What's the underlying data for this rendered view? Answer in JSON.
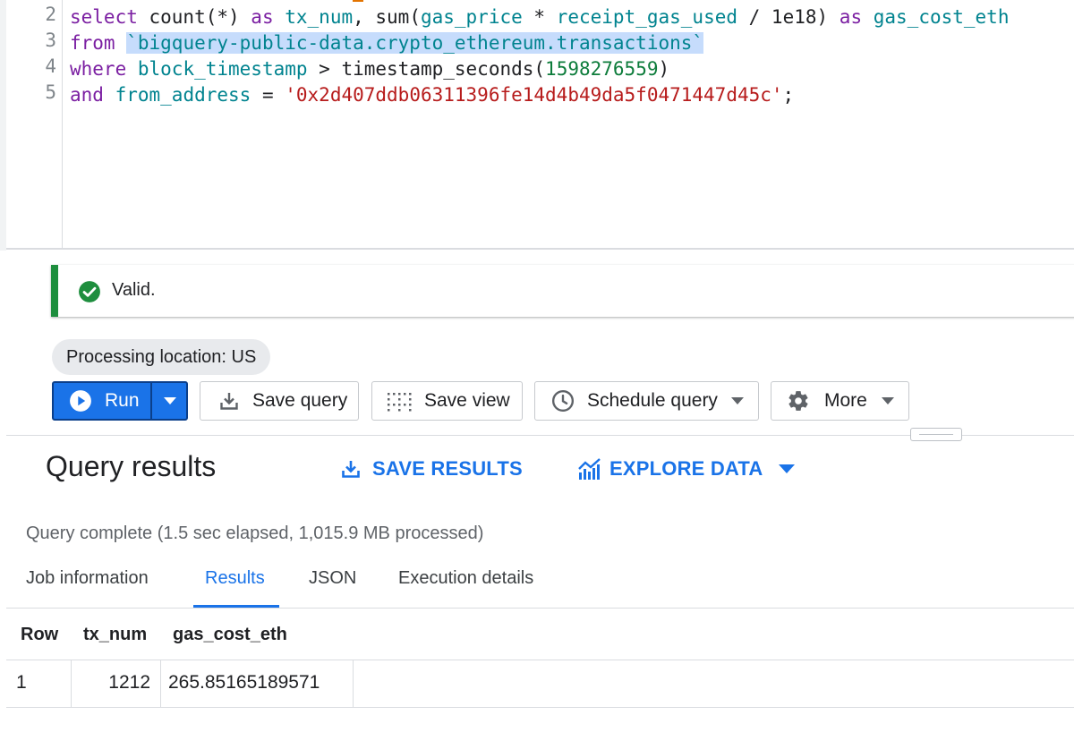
{
  "editor": {
    "line_numbers": [
      "2",
      "3",
      "4",
      "5"
    ],
    "line2": {
      "kw_select": "select",
      "t1": " count(*) ",
      "kw_as1": "as",
      "sp1": " ",
      "id_tx_num": "tx_num",
      "t2": ", sum(",
      "id_gas_price": "gas_price",
      "t3": " * ",
      "id_receipt": "receipt_gas_used",
      "t4": " / 1e18) ",
      "kw_as2": "as",
      "sp2": " ",
      "id_gas_cost": "gas_cost_eth"
    },
    "line3": {
      "kw_from": "from",
      "sp": " ",
      "table_ref": "`bigquery-public-data.crypto_ethereum.transactions`"
    },
    "line4": {
      "kw_where": "where",
      "sp": " ",
      "id_block_ts": "block_timestamp",
      "t1": " > timestamp_seconds(",
      "num": "1598276559",
      "t2": ")"
    },
    "line5": {
      "kw_and": "and",
      "sp": " ",
      "id_from": "from_address",
      "t1": " = ",
      "str": "'0x2d407ddb06311396fe14d4b49da5f0471447d45c'",
      "t2": ";"
    }
  },
  "validator": {
    "message": "Valid.",
    "status_color": "#1e8e3e"
  },
  "processing_location": "Processing location: US",
  "toolbar": {
    "run_label": "Run",
    "save_query_label": "Save query",
    "save_view_label": "Save view",
    "schedule_label": "Schedule query",
    "more_label": "More",
    "accent_color": "#1a73e8"
  },
  "results": {
    "title": "Query results",
    "save_results_label": "SAVE RESULTS",
    "explore_data_label": "EXPLORE DATA",
    "status": "Query complete (1.5 sec elapsed, 1,015.9 MB processed)",
    "tabs": [
      "Job information",
      "Results",
      "JSON",
      "Execution details"
    ],
    "active_tab": "Results",
    "columns": [
      "Row",
      "tx_num",
      "gas_cost_eth"
    ],
    "rows": [
      [
        "1",
        "1212",
        "265.85165189571"
      ]
    ]
  }
}
